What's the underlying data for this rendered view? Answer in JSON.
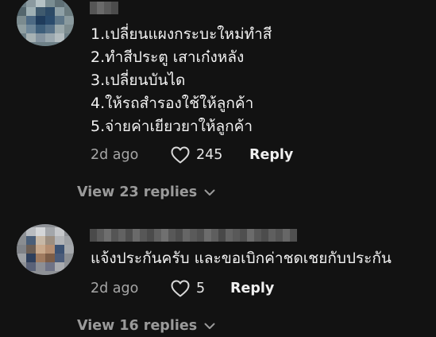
{
  "comments": [
    {
      "lines": [
        "1.เปลี่ยนแผงกระบะใหม่ทำสี",
        "2.ทำสีประตู เสาเก๋งหลัง",
        "3.เปลี่ยนบันได",
        "4.ให้รถสำรองใช้ให้ลูกค้า",
        "5.จ่ายค่าเยียวยาให้ลูกค้า"
      ],
      "time": "2d ago",
      "likes": "245",
      "reply_label": "Reply",
      "view_replies": "View 23 replies"
    },
    {
      "lines": [
        "แจ้งประกันครับ และขอเบิกค่าชดเชยกับประกัน"
      ],
      "time": "2d ago",
      "likes": "5",
      "reply_label": "Reply",
      "view_replies": "View 16 replies"
    }
  ],
  "colors": {
    "background": "#121212",
    "text": "#f2f2f2",
    "muted": "#a6a6a6"
  },
  "icons": {
    "like": "heart-outline-icon",
    "expand": "chevron-down-icon"
  }
}
